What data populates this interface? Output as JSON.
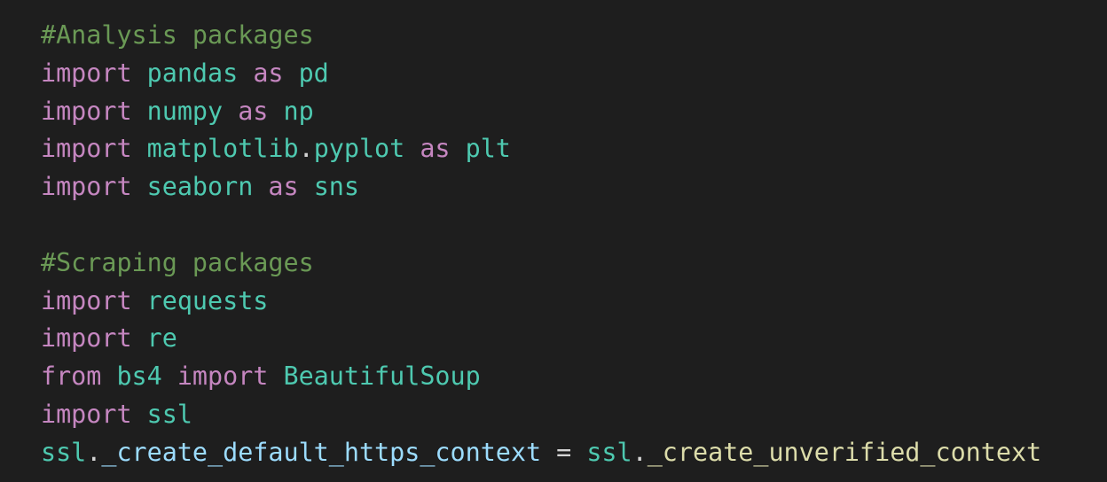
{
  "editor": {
    "background": "#1e1e1e",
    "colors": {
      "comment": "#6a9955",
      "keyword": "#c586c0",
      "module": "#4ec9b0",
      "class": "#4ec9b0",
      "variable": "#9cdcfe",
      "function": "#dcdcaa",
      "punct": "#d4d4d4",
      "operator": "#d4d4d4"
    },
    "lines": [
      [
        {
          "t": "#Analysis packages",
          "c": "comment"
        }
      ],
      [
        {
          "t": "import",
          "c": "keyword"
        },
        {
          "t": " "
        },
        {
          "t": "pandas",
          "c": "module"
        },
        {
          "t": " "
        },
        {
          "t": "as",
          "c": "keyword"
        },
        {
          "t": " "
        },
        {
          "t": "pd",
          "c": "module"
        }
      ],
      [
        {
          "t": "import",
          "c": "keyword"
        },
        {
          "t": " "
        },
        {
          "t": "numpy",
          "c": "module"
        },
        {
          "t": " "
        },
        {
          "t": "as",
          "c": "keyword"
        },
        {
          "t": " "
        },
        {
          "t": "np",
          "c": "module"
        }
      ],
      [
        {
          "t": "import",
          "c": "keyword"
        },
        {
          "t": " "
        },
        {
          "t": "matplotlib",
          "c": "module"
        },
        {
          "t": ".",
          "c": "punct"
        },
        {
          "t": "pyplot",
          "c": "module"
        },
        {
          "t": " "
        },
        {
          "t": "as",
          "c": "keyword"
        },
        {
          "t": " "
        },
        {
          "t": "plt",
          "c": "module"
        }
      ],
      [
        {
          "t": "import",
          "c": "keyword"
        },
        {
          "t": " "
        },
        {
          "t": "seaborn",
          "c": "module"
        },
        {
          "t": " "
        },
        {
          "t": "as",
          "c": "keyword"
        },
        {
          "t": " "
        },
        {
          "t": "sns",
          "c": "module"
        }
      ],
      [],
      [
        {
          "t": "#Scraping packages",
          "c": "comment"
        }
      ],
      [
        {
          "t": "import",
          "c": "keyword"
        },
        {
          "t": " "
        },
        {
          "t": "requests",
          "c": "module"
        }
      ],
      [
        {
          "t": "import",
          "c": "keyword"
        },
        {
          "t": " "
        },
        {
          "t": "re",
          "c": "module"
        }
      ],
      [
        {
          "t": "from",
          "c": "keyword"
        },
        {
          "t": " "
        },
        {
          "t": "bs4",
          "c": "module"
        },
        {
          "t": " "
        },
        {
          "t": "import",
          "c": "keyword"
        },
        {
          "t": " "
        },
        {
          "t": "BeautifulSoup",
          "c": "class"
        }
      ],
      [
        {
          "t": "import",
          "c": "keyword"
        },
        {
          "t": " "
        },
        {
          "t": "ssl",
          "c": "module"
        }
      ],
      [
        {
          "t": "ssl",
          "c": "module"
        },
        {
          "t": ".",
          "c": "punct"
        },
        {
          "t": "_create_default_https_context",
          "c": "variable"
        },
        {
          "t": " "
        },
        {
          "t": "=",
          "c": "operator"
        },
        {
          "t": " "
        },
        {
          "t": "ssl",
          "c": "module"
        },
        {
          "t": ".",
          "c": "punct"
        },
        {
          "t": "_create_unverified_context",
          "c": "function"
        }
      ]
    ]
  }
}
